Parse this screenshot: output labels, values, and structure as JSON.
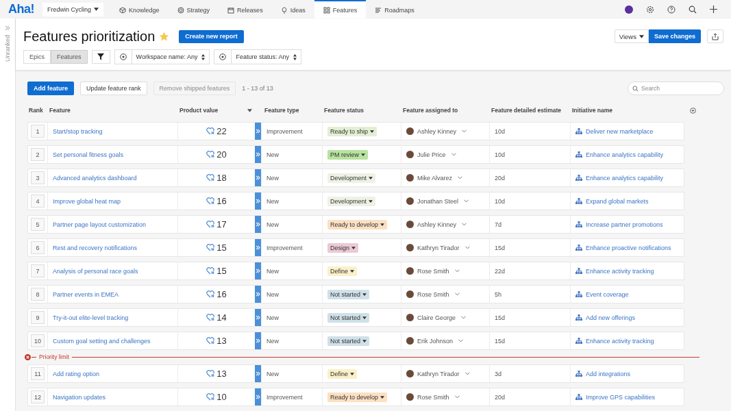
{
  "nav": {
    "logo": "Aha!",
    "workspace": "Fredwin Cycling",
    "tabs": [
      {
        "label": "Knowledge",
        "selected": false
      },
      {
        "label": "Strategy",
        "selected": false
      },
      {
        "label": "Releases",
        "selected": false
      },
      {
        "label": "Ideas",
        "selected": false
      },
      {
        "label": "Features",
        "selected": true
      },
      {
        "label": "Roadmaps",
        "selected": false
      }
    ]
  },
  "sidebar": {
    "label": "Unranked"
  },
  "header": {
    "title": "Features prioritization",
    "starred": true,
    "create_button": "Create new report",
    "views_button": "Views",
    "save_button": "Save changes",
    "segments": [
      {
        "label": "Epics",
        "selected": false
      },
      {
        "label": "Features",
        "selected": true
      }
    ],
    "filters": [
      {
        "label": "Workspace name: Any"
      },
      {
        "label": "Feature status: Any"
      }
    ]
  },
  "toolbar": {
    "add_button": "Add feature",
    "rank_button": "Update feature rank",
    "remove_button": {
      "label": "Remove shipped features",
      "disabled": true
    },
    "count": "1 - 13 of 13",
    "search": {
      "placeholder": "Search"
    }
  },
  "table": {
    "columns": [
      "Rank",
      "Feature",
      "Product value",
      "Feature type",
      "Feature status",
      "Feature assigned to",
      "Feature detailed estimate",
      "Initiative name"
    ],
    "rows_above_limit": [
      {
        "rank": "1",
        "feature": "Start/stop tracking",
        "value": "22",
        "type": "Improvement",
        "status": "Ready to ship",
        "color": "#e2efd2",
        "assignee": "Ashley Kinney",
        "estimate": "10d",
        "initiative": "Deliver new marketplace"
      },
      {
        "rank": "2",
        "feature": "Set personal fitness goals",
        "value": "20",
        "type": "New",
        "status": "PM review",
        "color": "#b8e29e",
        "assignee": "Julie Price",
        "estimate": "10d",
        "initiative": "Enhance analytics capability"
      },
      {
        "rank": "3",
        "feature": "Advanced analytics dashboard",
        "value": "18",
        "type": "New",
        "status": "Development",
        "color": "#edf2e4",
        "assignee": "Mike Alvarez",
        "estimate": "20d",
        "initiative": "Enhance analytics capability"
      },
      {
        "rank": "4",
        "feature": "Improve global heat map",
        "value": "16",
        "type": "New",
        "status": "Development",
        "color": "#edf2e4",
        "assignee": "Jonathan Steel",
        "estimate": "10d",
        "initiative": "Expand global markets"
      },
      {
        "rank": "5",
        "feature": "Partner page layout customization",
        "value": "17",
        "type": "New",
        "status": "Ready to develop",
        "color": "#fce0c2",
        "assignee": "Ashley Kinney",
        "estimate": "7d",
        "initiative": "Increase partner promotions"
      },
      {
        "rank": "6",
        "feature": "Rest and recovery notifications",
        "value": "15",
        "type": "Improvement",
        "status": "Design",
        "color": "#ebcad4",
        "assignee": "Kathryn Tirador",
        "estimate": "15d",
        "initiative": "Enhance proactive notifications"
      },
      {
        "rank": "7",
        "feature": "Analysis of personal race goals",
        "value": "15",
        "type": "New",
        "status": "Define",
        "color": "#faf0c9",
        "assignee": "Rose Smith",
        "estimate": "22d",
        "initiative": "Enhance activity tracking"
      },
      {
        "rank": "8",
        "feature": "Partner events in EMEA",
        "value": "16",
        "type": "New",
        "status": "Not started",
        "color": "#cfe0e8",
        "assignee": "Rose Smith",
        "estimate": "5h",
        "initiative": "Event coverage"
      },
      {
        "rank": "9",
        "feature": "Try-it-out elite-level tracking",
        "value": "14",
        "type": "New",
        "status": "Not started",
        "color": "#cfe0e8",
        "assignee": "Claire George",
        "estimate": "15d",
        "initiative": "Add new offerings"
      },
      {
        "rank": "10",
        "feature": "Custom goal setting and challenges",
        "value": "13",
        "type": "New",
        "status": "Not started",
        "color": "#cfe0e8",
        "assignee": "Erik Johnson",
        "estimate": "15d",
        "initiative": "Enhance activity tracking"
      }
    ],
    "priority_limit": {
      "label": "Priority limit"
    },
    "rows_below_limit": [
      {
        "rank": "11",
        "feature": "Add rating option",
        "value": "13",
        "type": "New",
        "status": "Define",
        "color": "#faf0c9",
        "assignee": "Kathryn Tirador",
        "estimate": "3d",
        "initiative": "Add integrations"
      },
      {
        "rank": "12",
        "feature": "Navigation updates",
        "value": "10",
        "type": "Improvement",
        "status": "Ready to develop",
        "color": "#fce0c2",
        "assignee": "Rose Smith",
        "estimate": "20d",
        "initiative": "Improve GPS capabilities"
      }
    ]
  }
}
